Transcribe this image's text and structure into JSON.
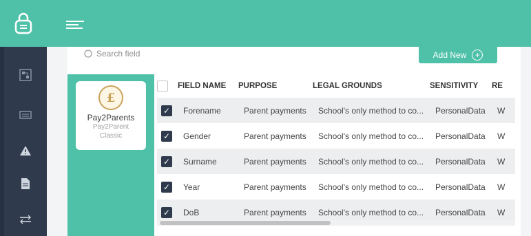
{
  "colors": {
    "accent": "#4fc1a9",
    "sidebar": "#2f3b4d",
    "row_alt": "#eceef0"
  },
  "topbar": {
    "logo_icon": "lock-icon",
    "menu_icon": "menu-icon"
  },
  "sidebar": {
    "items": [
      {
        "icon": "org-chart-icon"
      },
      {
        "icon": "keyboard-icon"
      },
      {
        "icon": "warning-icon"
      },
      {
        "icon": "document-icon"
      },
      {
        "icon": "transfer-icon"
      }
    ]
  },
  "search": {
    "placeholder": "Search field",
    "icon": "search-icon"
  },
  "add_button": {
    "label": "Add New",
    "icon": "plus-icon",
    "icon_glyph": "+"
  },
  "app_card": {
    "logo_text": "£",
    "name": "Pay2Parents",
    "subtitle_line1": "Pay2Parent",
    "subtitle_line2": "Classic"
  },
  "table": {
    "columns": [
      "FIELD NAME",
      "PURPOSE",
      "LEGAL GROUNDS",
      "SENSITIVITY",
      "RE"
    ],
    "rows": [
      {
        "checked": true,
        "field": "Forename",
        "purpose": "Parent payments",
        "legal": "School's only method to co...",
        "sensitivity": "PersonalData",
        "extra": "W"
      },
      {
        "checked": true,
        "field": "Gender",
        "purpose": "Parent payments",
        "legal": "School's only method to co...",
        "sensitivity": "PersonalData",
        "extra": "W"
      },
      {
        "checked": true,
        "field": "Surname",
        "purpose": "Parent payments",
        "legal": "School's only method to co...",
        "sensitivity": "PersonalData",
        "extra": "W"
      },
      {
        "checked": true,
        "field": "Year",
        "purpose": "Parent payments",
        "legal": "School's only method to co...",
        "sensitivity": "PersonalData",
        "extra": "W"
      },
      {
        "checked": true,
        "field": "DoB",
        "purpose": "Parent payments",
        "legal": "School's only method to co...",
        "sensitivity": "PersonalData",
        "extra": "W"
      }
    ],
    "check_glyph": "✓"
  }
}
